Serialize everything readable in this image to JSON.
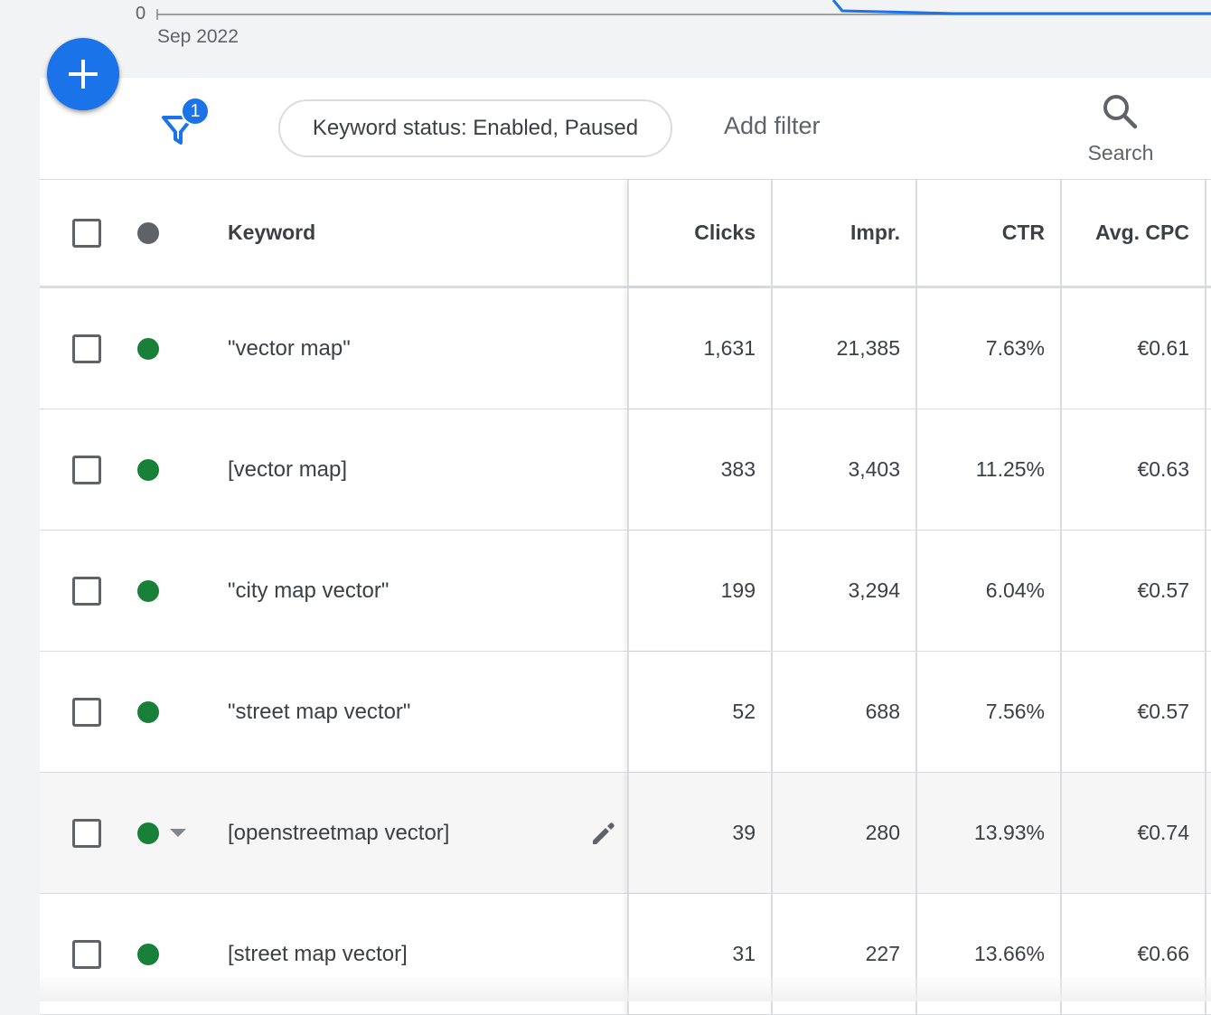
{
  "chart": {
    "y_zero_label": "0",
    "x_start_label": "Sep 2022",
    "line_color": "#1a73e8"
  },
  "fab": {
    "icon": "plus-icon"
  },
  "toolbar": {
    "filter_icon": "filter-icon",
    "filter_count": "1",
    "active_filter_chip": "Keyword status: Enabled, Paused",
    "add_filter_label": "Add filter",
    "search_icon": "search-icon",
    "search_label": "Search"
  },
  "table": {
    "columns": {
      "keyword": "Keyword",
      "clicks": "Clicks",
      "impr": "Impr.",
      "ctr": "CTR",
      "avg_cpc": "Avg. CPC"
    },
    "header_status_color": "#5f6368",
    "enabled_status_color": "#188038",
    "rows": [
      {
        "keyword": "\"vector map\"",
        "clicks": "1,631",
        "impr": "21,385",
        "ctr": "7.63%",
        "avg_cpc": "€0.61"
      },
      {
        "keyword": "[vector map]",
        "clicks": "383",
        "impr": "3,403",
        "ctr": "11.25%",
        "avg_cpc": "€0.63"
      },
      {
        "keyword": "\"city map vector\"",
        "clicks": "199",
        "impr": "3,294",
        "ctr": "6.04%",
        "avg_cpc": "€0.57"
      },
      {
        "keyword": "\"street map vector\"",
        "clicks": "52",
        "impr": "688",
        "ctr": "7.56%",
        "avg_cpc": "€0.57"
      },
      {
        "keyword": "[openstreetmap vector]",
        "clicks": "39",
        "impr": "280",
        "ctr": "13.93%",
        "avg_cpc": "€0.74",
        "hovered": true
      },
      {
        "keyword": "[street map vector]",
        "clicks": "31",
        "impr": "227",
        "ctr": "13.66%",
        "avg_cpc": "€0.66"
      }
    ]
  }
}
